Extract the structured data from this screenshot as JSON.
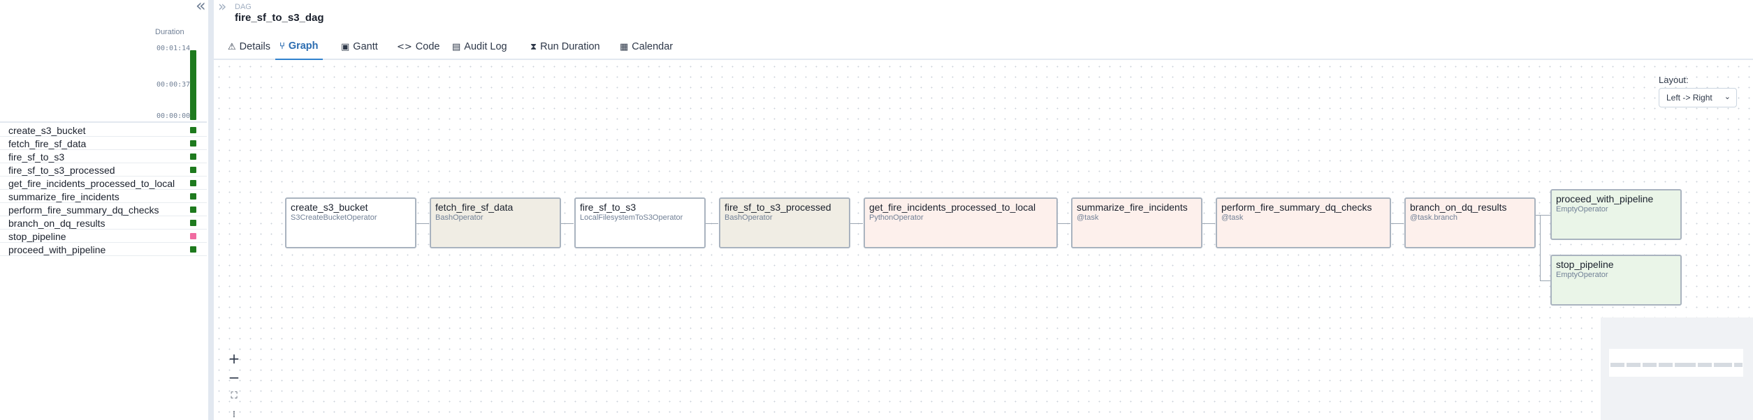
{
  "left_panel": {
    "collapse_glyph": "«",
    "duration_label": "Duration",
    "ticks": {
      "top": "00:01:14",
      "mid": "00:00:37",
      "bottom": "00:00:00"
    },
    "run_status_color": "#1e7a1e",
    "tasks": [
      {
        "name": "create_s3_bucket",
        "status_color": "#1e7a1e"
      },
      {
        "name": "fetch_fire_sf_data",
        "status_color": "#1e7a1e"
      },
      {
        "name": "fire_sf_to_s3",
        "status_color": "#1e7a1e"
      },
      {
        "name": "fire_sf_to_s3_processed",
        "status_color": "#1e7a1e"
      },
      {
        "name": "get_fire_incidents_processed_to_local",
        "status_color": "#1e7a1e"
      },
      {
        "name": "summarize_fire_incidents",
        "status_color": "#1e7a1e"
      },
      {
        "name": "perform_fire_summary_dq_checks",
        "status_color": "#1e7a1e"
      },
      {
        "name": "branch_on_dq_results",
        "status_color": "#1e7a1e"
      },
      {
        "name": "stop_pipeline",
        "status_color": "#f06ba0"
      },
      {
        "name": "proceed_with_pipeline",
        "status_color": "#1e7a1e"
      }
    ]
  },
  "header": {
    "expand_glyph": "»",
    "breadcrumb": "DAG",
    "dag_id": "fire_sf_to_s3_dag"
  },
  "tabs": [
    {
      "label": "Details",
      "icon": "⚠"
    },
    {
      "label": "Graph",
      "icon": "⑂"
    },
    {
      "label": "Gantt",
      "icon": "▣"
    },
    {
      "label": "Code",
      "icon": "<>"
    },
    {
      "label": "Audit Log",
      "icon": "▤"
    },
    {
      "label": "Run Duration",
      "icon": "⧗"
    },
    {
      "label": "Calendar",
      "icon": "▦"
    }
  ],
  "graph": {
    "layout_label": "Layout:",
    "layout_value": "Left -> Right",
    "layout_chevron": "⌄",
    "nodes": [
      {
        "name": "create_s3_bucket",
        "operator": "S3CreateBucketOperator",
        "bg": "#ffffff"
      },
      {
        "name": "fetch_fire_sf_data",
        "operator": "BashOperator",
        "bg": "#f0ede4"
      },
      {
        "name": "fire_sf_to_s3",
        "operator": "LocalFilesystemToS3Operator",
        "bg": "#ffffff"
      },
      {
        "name": "fire_sf_to_s3_processed",
        "operator": "BashOperator",
        "bg": "#f0ede4"
      },
      {
        "name": "get_fire_incidents_processed_to_local",
        "operator": "PythonOperator",
        "bg": "#fdf0ec"
      },
      {
        "name": "summarize_fire_incidents",
        "operator": "@task",
        "bg": "#fdf0ec"
      },
      {
        "name": "perform_fire_summary_dq_checks",
        "operator": "@task",
        "bg": "#fdf0ec"
      },
      {
        "name": "branch_on_dq_results",
        "operator": "@task.branch",
        "bg": "#fdf0ec"
      },
      {
        "name": "proceed_with_pipeline",
        "operator": "EmptyOperator",
        "bg": "#eaf5e8"
      },
      {
        "name": "stop_pipeline",
        "operator": "EmptyOperator",
        "bg": "#eaf5e8"
      }
    ],
    "zoom": {
      "in": "+",
      "out": "−",
      "fit": "⛶",
      "lock": "⁞"
    }
  }
}
